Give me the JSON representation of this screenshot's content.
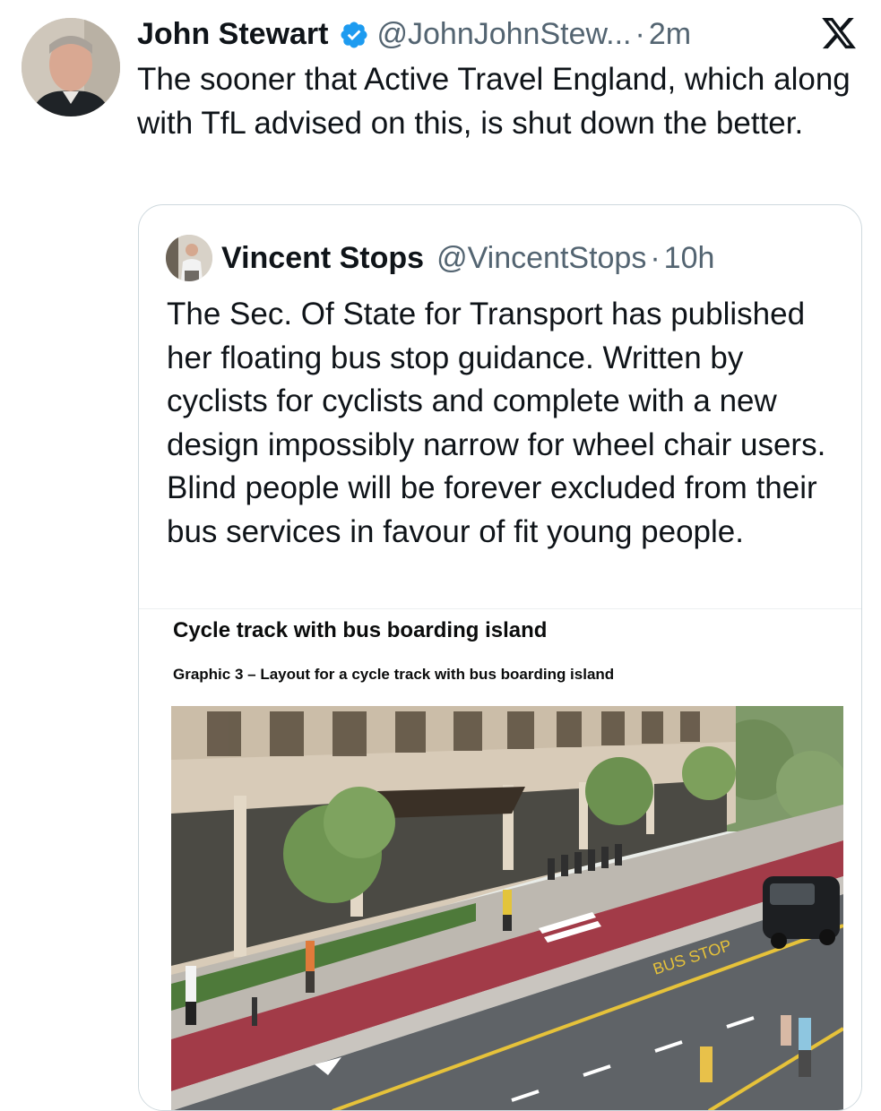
{
  "tweet": {
    "author_name": "John Stewart",
    "handle": "@JohnJohnStew...",
    "separator": "·",
    "time": "2m",
    "text": "The sooner that Active Travel England, which along with TfL advised on this, is shut down the better."
  },
  "quoted_tweet": {
    "author_name": "Vincent Stops",
    "handle": "@VincentStops",
    "separator": "·",
    "time": "10h",
    "text": "The Sec. Of State for Transport has published her floating bus stop guidance. Written by cyclists for cyclists and complete with a new design impossibly narrow for wheel chair users. Blind people will be forever excluded from their bus services in favour of fit young people."
  },
  "media": {
    "title": "Cycle track with bus boarding island",
    "subtitle": "Graphic 3 – Layout for a cycle track with bus boarding island",
    "road_marking": "BUS STOP"
  },
  "icons": {
    "verified": "verified-badge-icon",
    "platform": "x-logo-icon"
  },
  "colors": {
    "verified_blue": "#1d9bf0",
    "secondary_text": "#536471",
    "cycle_track": "#a23b48",
    "road": "#5f6367"
  }
}
